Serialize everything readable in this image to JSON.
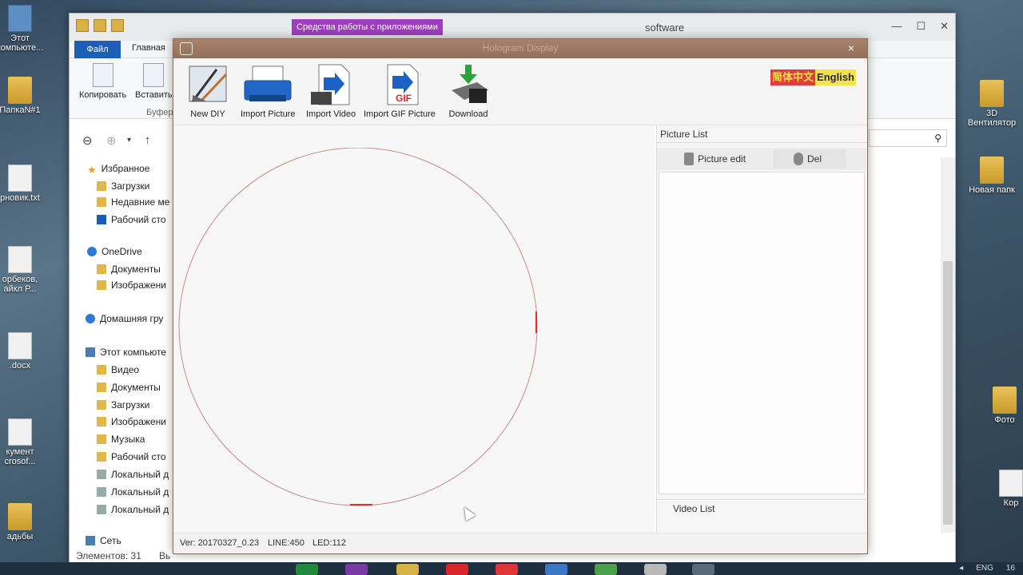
{
  "desktop": {
    "icons_left": [
      {
        "label": "Этот\nкомпьюте..."
      },
      {
        "label": "ПапкаN#1"
      },
      {
        "label": "рновик.txt"
      },
      {
        "label": "орбеков,\nайкл Р..."
      },
      {
        "label": ".docx"
      },
      {
        "label": "кумент\ncrosof..."
      },
      {
        "label": "адьбы"
      }
    ],
    "icons_right": [
      {
        "label": "3D\nВентилятор"
      },
      {
        "label": "Новая папк"
      },
      {
        "label": "Фото"
      },
      {
        "label": "Кор"
      }
    ]
  },
  "explorer": {
    "contextual_tab": "Средства работы с приложениями",
    "title": "software",
    "controls": [
      "—",
      "☐",
      "✕"
    ],
    "tab_file": "Файл",
    "tab_home": "Главная",
    "ribbon": {
      "copy": "Копировать",
      "paste": "Вставить",
      "group_label": "Буфер"
    },
    "nav": {
      "favorites": "Избранное",
      "downloads": "Загрузки",
      "recent": "Недавние ме",
      "desktop": "Рабочий сто",
      "onedrive": "OneDrive",
      "documents": "Документы",
      "images": "Изображени",
      "homegroup": "Домашняя гру",
      "this_pc": "Этот компьюте",
      "video": "Видео",
      "pc_documents": "Документы",
      "pc_downloads": "Загрузки",
      "pc_images": "Изображени",
      "music": "Музыка",
      "pc_desktop": "Рабочий сто",
      "disk1": "Локальный д",
      "disk2": "Локальный д",
      "disk3": "Локальный д",
      "network": "Сеть"
    },
    "status": "Элементов: 31",
    "status_extra": "Вь"
  },
  "holo": {
    "title": "Hologram Display",
    "close": "×",
    "toolbar": {
      "new_diy": "New DIY",
      "import_picture": "Import Picture",
      "import_video": "Import Video",
      "import_gif": "Import GIF Picture",
      "download": "Download",
      "gif_badge": "GIF"
    },
    "lang_zh": "简体中文",
    "lang_en": "English",
    "picture_list": "Picture List",
    "picture_edit": "Picture edit",
    "del": "Del",
    "video_list": "Video List",
    "status": {
      "ver": "Ver: 20170327_0.23",
      "line": "LINE:450",
      "led": "LED:112"
    }
  },
  "taskbar": {
    "lang": "ENG",
    "time": "16"
  },
  "colors": {
    "holo_title": "#93705a",
    "circle": "#c98b8b",
    "lang_zh_bg": "#e23d3d",
    "lang_en_bg": "#f5e24d",
    "file_tab": "#1c5fb6",
    "context_tab": "#a03cc0"
  }
}
